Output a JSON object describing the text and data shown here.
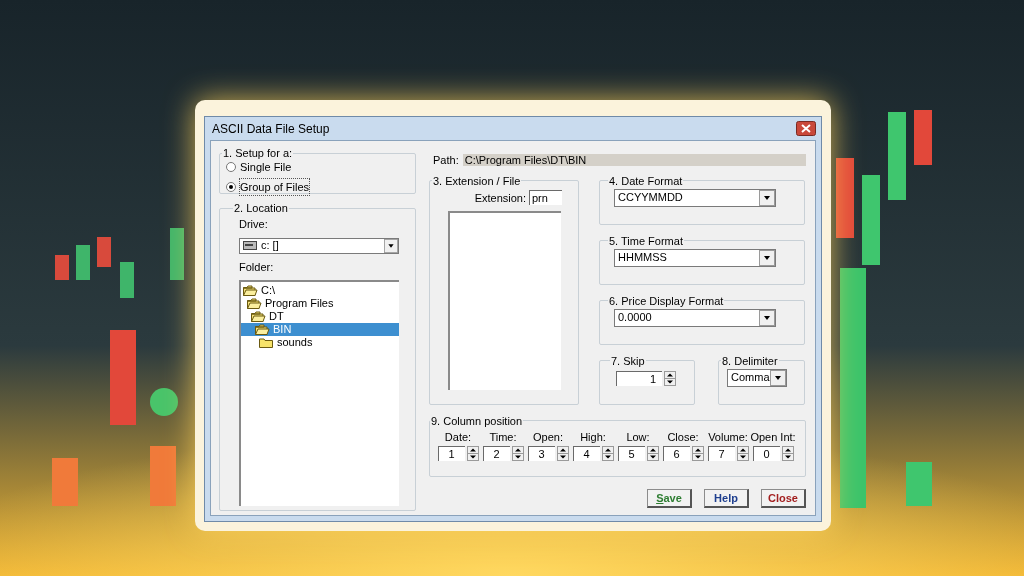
{
  "window": {
    "title": "ASCII Data File Setup"
  },
  "setup": {
    "legend": "1. Setup for a:",
    "options": [
      {
        "label": "Single File",
        "selected": false
      },
      {
        "label": "Group of Files",
        "selected": true
      }
    ]
  },
  "location": {
    "legend": "2. Location",
    "drive_label": "Drive:",
    "drive": "c: []",
    "folder_label": "Folder:",
    "folders": [
      {
        "name": "C:\\",
        "selected": false,
        "children": [
          {
            "name": "Program Files",
            "selected": false,
            "children": [
              {
                "name": "DT",
                "selected": false,
                "children": [
                  {
                    "name": "BIN",
                    "selected": true,
                    "children": [
                      {
                        "name": "sounds",
                        "selected": false
                      }
                    ]
                  }
                ]
              }
            ]
          }
        ]
      }
    ]
  },
  "path": {
    "label": "Path:",
    "value": "C:\\Program Files\\DT\\BIN"
  },
  "extension": {
    "legend": "3. Extension / File",
    "label": "Extension:",
    "value": "prn"
  },
  "date_format": {
    "legend": "4. Date Format",
    "value": "CCYYMMDD"
  },
  "time_format": {
    "legend": "5. Time Format",
    "value": "HHMMSS"
  },
  "price_format": {
    "legend": "6. Price Display Format",
    "value": "0.0000"
  },
  "skip": {
    "legend": "7. Skip",
    "value": "1"
  },
  "delimiter": {
    "legend": "8. Delimiter",
    "value": "Comma"
  },
  "columns": {
    "legend": "9. Column position",
    "fields": [
      {
        "label": "Date:",
        "value": "1"
      },
      {
        "label": "Time:",
        "value": "2"
      },
      {
        "label": "Open:",
        "value": "3"
      },
      {
        "label": "High:",
        "value": "4"
      },
      {
        "label": "Low:",
        "value": "5"
      },
      {
        "label": "Close:",
        "value": "6"
      },
      {
        "label": "Volume:",
        "value": "7"
      },
      {
        "label": "Open Int:",
        "value": "0"
      }
    ]
  },
  "buttons": [
    {
      "label": "Save",
      "color": "#2e7d32",
      "underline_first": true
    },
    {
      "label": "Help",
      "color": "#1f3f8f",
      "underline_first": false
    },
    {
      "label": "Close",
      "color": "#a31f1f",
      "underline_first": false
    }
  ]
}
